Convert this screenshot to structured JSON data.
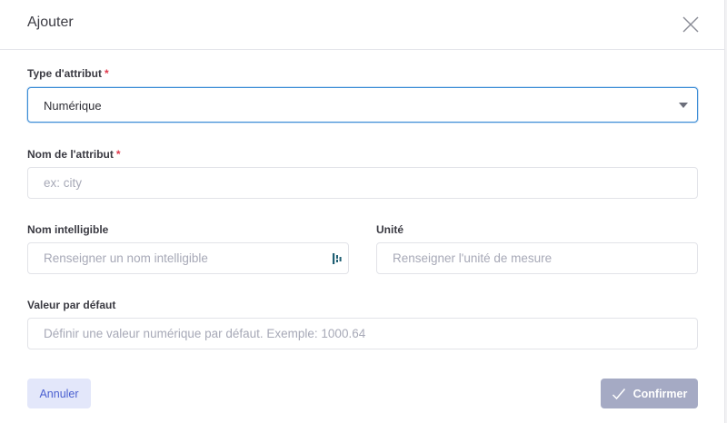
{
  "dialog": {
    "title": "Ajouter"
  },
  "form": {
    "attribute_type": {
      "label": "Type d'attribut",
      "required_mark": "*",
      "selected_value": "Numérique"
    },
    "attribute_name": {
      "label": "Nom de l'attribut",
      "required_mark": "*",
      "placeholder": "ex: city",
      "value": ""
    },
    "readable_name": {
      "label": "Nom intelligible",
      "placeholder": "Renseigner un nom intelligible",
      "value": ""
    },
    "unit": {
      "label": "Unité",
      "placeholder": "Renseigner l'unité de mesure",
      "value": ""
    },
    "default_value": {
      "label": "Valeur par défaut",
      "placeholder": "Définir une valeur numérique par défaut. Exemple: 1000.64",
      "value": ""
    }
  },
  "actions": {
    "cancel_label": "Annuler",
    "confirm_label": "Confirmer"
  },
  "icons": {
    "close": "close-icon",
    "dropdown": "chevron-down-icon",
    "password_manager": "password-manager-icon",
    "confirm": "check-icon"
  },
  "colors": {
    "focus_border": "#3b8cd6",
    "required": "#e0384b",
    "cancel_bg": "#e3e7fa",
    "cancel_text": "#4a5fd0",
    "confirm_bg_disabled": "#a5aac4"
  }
}
